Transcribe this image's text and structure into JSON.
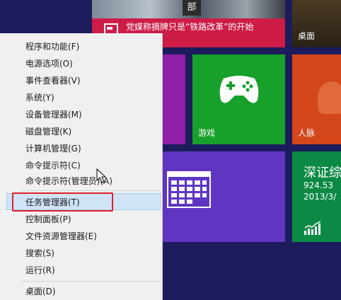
{
  "tiles": {
    "news": {
      "photo_sign": "部",
      "headline": "党媒称摘牌只是“铁路改革”的开始"
    },
    "desktop": {
      "label": "桌面"
    },
    "games": {
      "label": "游戏"
    },
    "people": {
      "label": "人脉"
    },
    "finance": {
      "title": "深证综",
      "value": "924.53",
      "date": "2013/3/"
    }
  },
  "context_menu": {
    "group1": [
      "程序和功能(F)",
      "电源选项(O)",
      "事件查看器(V)",
      "系统(Y)",
      "设备管理器(M)",
      "磁盘管理(K)",
      "计算机管理(G)",
      "命令提示符(C)",
      "命令提示符(管理员)(A)"
    ],
    "group2": [
      "任务管理器(T)",
      "控制面板(P)",
      "文件资源管理器(E)",
      "搜索(S)",
      "运行(R)"
    ],
    "group3": [
      "桌面(D)"
    ],
    "highlighted_item": "任务管理器(T)"
  },
  "colors": {
    "background": "#1c1c5c",
    "news_tile": "#cd1c46",
    "games_tile": "#17a02b",
    "people_tile": "#d3471a",
    "calendar_tile": "#5f35c2",
    "finance_tile": "#0c8a45",
    "purple_tile": "#8f1fa8",
    "annotation": "#e01e2a"
  }
}
